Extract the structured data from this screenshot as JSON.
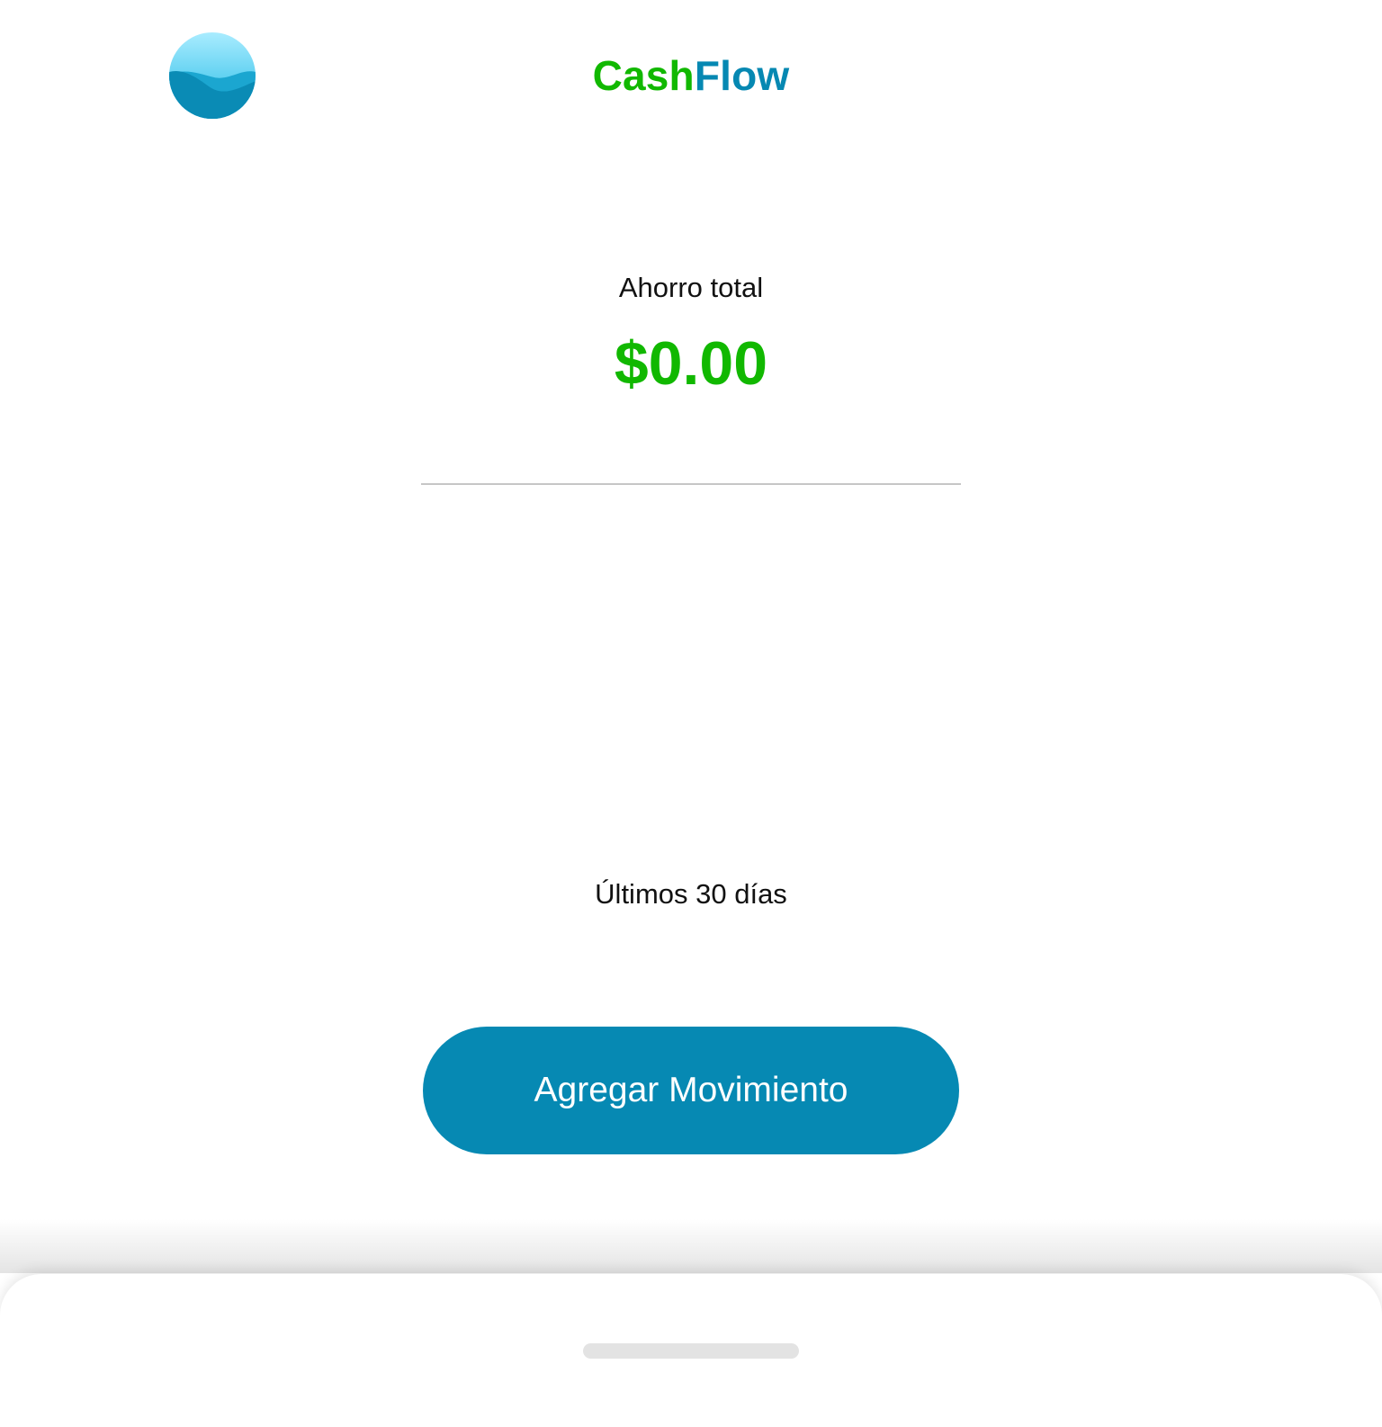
{
  "header": {
    "logo_icon": "ocean-wave-icon",
    "brand_part1": "Cash",
    "brand_part2": "Flow"
  },
  "summary": {
    "label": "Ahorro total",
    "amount": "$0.00"
  },
  "period": {
    "label": "Últimos 30 días"
  },
  "actions": {
    "add_label": "Agregar Movimiento"
  },
  "colors": {
    "brand_green": "#11b800",
    "brand_blue": "#0688b2",
    "button_blue": "#0689b3",
    "divider": "#c6c6c6",
    "handle": "#e3e3e3"
  }
}
